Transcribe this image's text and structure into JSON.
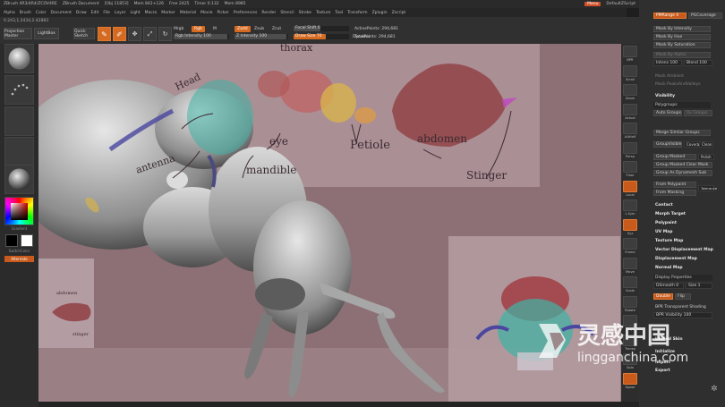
{
  "titlebar": {
    "items": [
      "ZBrush 4R3/4R4/ZCOV4RE",
      "ZBrush Document",
      "[Obj 11853]",
      "Mem 842+126",
      "Free 2425",
      "Timer 0.132",
      "Mem 8985"
    ],
    "menu_btn": "Menu",
    "script_label": "DefaultZScript"
  },
  "menubar": {
    "items": [
      "Alpha",
      "Brush",
      "Color",
      "Document",
      "Draw",
      "Edit",
      "File",
      "Layer",
      "Light",
      "Macro",
      "Marker",
      "Material",
      "Movie",
      "Picker",
      "Preferences",
      "Render",
      "Stencil",
      "Stroke",
      "Texture",
      "Tool",
      "Transform",
      "Zplugin",
      "Zscript"
    ]
  },
  "toolbar": {
    "projection_master": "Projection Master",
    "lightbox": "LightBox",
    "quick_sketch": "Quick Sketch",
    "edit": "Edit",
    "draw": "Draw",
    "move": "Move",
    "scale": "Scale",
    "rotate": "Rotate",
    "mrgb": "Mrgb",
    "rgb": "Rgb",
    "m": "M",
    "rgb_intensity": "Rgb Intensity 100",
    "zadd": "Zadd",
    "zsub": "Zsub",
    "zcut": "Zcut",
    "z_intensity": "Z Intensity 100",
    "focal_shift": "Focal Shift 0",
    "draw_size": "Draw Size 70",
    "dynamic": "Dynamic",
    "active_points": "ActivePoints: 294,681",
    "total_points": "TotalPoints: 294,681",
    "coords": "0.243,1.2434,2.42883"
  },
  "left_tray": {
    "gradient": "Gradient",
    "switch_color": "SwitchColor",
    "alternate": "Alternate"
  },
  "canvas": {
    "labels": {
      "head": "Head",
      "thorax": "thorax",
      "antenna": "antenna",
      "eye": "eye",
      "mandible": "mandible",
      "petiole": "Petiole",
      "abdomen": "abdomen",
      "stinger": "Stinger",
      "small_abdomen": "abdomen",
      "small_stinger": "stinger"
    }
  },
  "right_icons": [
    {
      "label": "BPR",
      "orange": false
    },
    {
      "label": "Scroll",
      "orange": false
    },
    {
      "label": "Zoom",
      "orange": false
    },
    {
      "label": "Actual",
      "orange": false
    },
    {
      "label": "AAHalf",
      "orange": false
    },
    {
      "label": "Persp",
      "orange": false
    },
    {
      "label": "Floor",
      "orange": false
    },
    {
      "label": "Local",
      "orange": true
    },
    {
      "label": "L.Sym",
      "orange": false
    },
    {
      "label": "Xyz",
      "orange": true
    },
    {
      "label": "Frame",
      "orange": false
    },
    {
      "label": "Move",
      "orange": false
    },
    {
      "label": "Scale",
      "orange": false
    },
    {
      "label": "Rotate",
      "orange": false
    },
    {
      "label": "PolyF",
      "orange": false
    },
    {
      "label": "Transp",
      "orange": false
    },
    {
      "label": "Solo",
      "orange": false
    },
    {
      "label": "Xpose",
      "orange": true
    }
  ],
  "right_panel": {
    "polypaint_top": {
      "pm_range": "PMRange 4",
      "pg_coverage": "PGCoverage"
    },
    "mask_by_intensity": "Mask By Intensity",
    "mask_by_hue": "Mask By Hue",
    "mask_by_saturation": "Mask By Saturation",
    "mask_by_alpha": "Mask By Alpha",
    "intens": "Intens 100",
    "blend": "Blend 100",
    "mask_ambient": "Mask Ambient",
    "mask_peaks_valleys": "Mask PeaksAndValleys",
    "visibility": "Visibility",
    "polygroups": "Polygroups",
    "auto_groups": "Auto Groups",
    "uv_groups": "Uv Groups",
    "merge_similar_groups": "Merge Similar Groups",
    "group_visible": "GroupVisible",
    "coverage": "Coverage",
    "clean": "Clean",
    "group_masked": "Group Masked",
    "polish": "Polish",
    "group_masked_clear_mask": "Group Masked Clear Mask",
    "group_as_dynamesh_sub": "Group As Dynamesh Sub",
    "from_polypaint": "From Polypaint",
    "from_masking": "From Masking",
    "tolerance": "Tolerance",
    "contact": "Contact",
    "morph_target": "Morph Target",
    "polypaint": "Polypaint",
    "uv_map": "UV Map",
    "texture_map": "Texture Map",
    "vector_displacement_map": "Vector Displacement Map",
    "displacement_map": "Displacement Map",
    "normal_map": "Normal Map",
    "display_properties": "Display Properties",
    "dsmooth": "DSmooth 0",
    "size": "Size 1",
    "double": "Double",
    "flip": "Flip",
    "bpr_transparent_shading": "BPR Transparent Shading",
    "bpr_visibility": "BPR Visibility 100",
    "unified_skin": "Unified Skin",
    "initialize": "Initialize",
    "import": "Import",
    "export": "Export"
  },
  "watermark": {
    "cn": "灵感中国",
    "url": "lingganchina.com"
  }
}
